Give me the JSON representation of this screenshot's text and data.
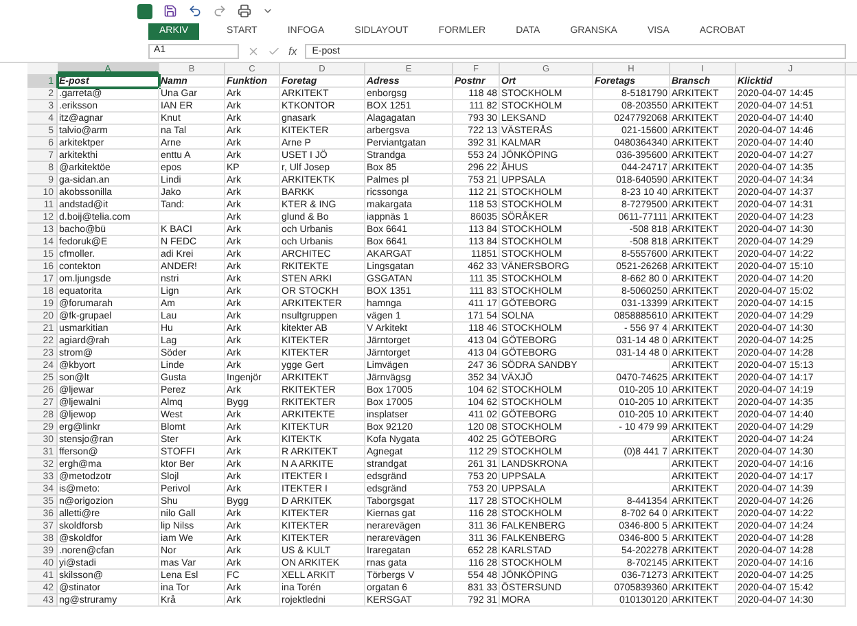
{
  "ribbon": {
    "tabs": [
      {
        "label": "ARKIV",
        "selected": true
      },
      {
        "label": "START",
        "selected": false
      },
      {
        "label": "INFOGA",
        "selected": false
      },
      {
        "label": "SIDLAYOUT",
        "selected": false
      },
      {
        "label": "FORMLER",
        "selected": false
      },
      {
        "label": "DATA",
        "selected": false
      },
      {
        "label": "GRANSKA",
        "selected": false
      },
      {
        "label": "VISA",
        "selected": false
      },
      {
        "label": "ACROBAT",
        "selected": false
      }
    ]
  },
  "formula_bar": {
    "name_box": "A1",
    "fx": "fx",
    "value": "E-post"
  },
  "columns": [
    {
      "letter": "A",
      "selected": true
    },
    {
      "letter": "B",
      "selected": false
    },
    {
      "letter": "C",
      "selected": false
    },
    {
      "letter": "D",
      "selected": false
    },
    {
      "letter": "E",
      "selected": false
    },
    {
      "letter": "F",
      "selected": false
    },
    {
      "letter": "G",
      "selected": false
    },
    {
      "letter": "H",
      "selected": false
    },
    {
      "letter": "I",
      "selected": false
    },
    {
      "letter": "J",
      "selected": false
    }
  ],
  "rows": [
    {
      "number": "1",
      "selected": true,
      "cells": [
        "E-post",
        "Namn",
        "Funktion",
        "Foretag",
        "Adress",
        "Postnr",
        "Ort",
        "Foretags",
        "Bransch",
        "Klicktid"
      ]
    },
    {
      "number": "2",
      "selected": false,
      "cells": [
        ".garreta@",
        "Una Gar",
        "Ark",
        "ARKITEKT",
        "enborgsg",
        "118 48",
        "STOCKHOLM",
        "8-5181790",
        "ARKITEKT",
        "2020-04-07 14:45"
      ]
    },
    {
      "number": "3",
      "selected": false,
      "cells": [
        ".eriksson",
        "IAN ER",
        "Ark",
        "KTKONTOR",
        "BOX 1251",
        "111 82",
        "STOCKHOLM",
        "08-203550",
        "ARKITEKT",
        "2020-04-07 14:51"
      ]
    },
    {
      "number": "4",
      "selected": false,
      "cells": [
        "itz@agnar",
        "Knut",
        "Ark",
        "gnasark",
        "Alagagatan",
        "793 30",
        "LEKSAND",
        "0247792068",
        "ARKITEKT",
        "2020-04-07 14:40"
      ]
    },
    {
      "number": "5",
      "selected": false,
      "cells": [
        "talvio@arm",
        "na Tal",
        "Ark",
        "KITEKTER",
        "arbergsva",
        "722 13",
        "VÄSTERÅS",
        "021-15600",
        "ARKITEKT",
        "2020-04-07 14:46"
      ]
    },
    {
      "number": "6",
      "selected": false,
      "cells": [
        "arkitektper",
        "Arne",
        "Ark",
        "Arne P",
        "Perviantgatan",
        "392 31",
        "KALMAR",
        "0480364340",
        "ARKITEKT",
        "2020-04-07 14:40"
      ]
    },
    {
      "number": "7",
      "selected": false,
      "cells": [
        "arkitekthi",
        "enttu A",
        "Ark",
        "USET I JÖ",
        "Strandga",
        "553 24",
        "JÖNKÖPING",
        "036-395600",
        "ARKITEKT",
        "2020-04-07 14:27"
      ]
    },
    {
      "number": "8",
      "selected": false,
      "cells": [
        "@arkitektöe",
        "epos",
        "KP",
        "r, Ulf Josep",
        "Box 85",
        "296 22",
        "ÅHUS",
        "044-24717",
        "ARKITEKT",
        "2020-04-07 14:35"
      ]
    },
    {
      "number": "9",
      "selected": false,
      "cells": [
        "ga-sidan.an",
        "Lindi",
        "Ark",
        "ARKITEKTK",
        "Palmes pl",
        "753 21",
        "UPPSALA",
        "018-640590",
        "ARKITEKT",
        "2020-04-07 14:34"
      ]
    },
    {
      "number": "10",
      "selected": false,
      "cells": [
        "akobssonilla",
        "Jako",
        "Ark",
        "BARKK",
        "ricssonga",
        "112 21",
        "STOCKHOLM",
        "8-23 10 40",
        "ARKITEKT",
        "2020-04-07 14:37"
      ]
    },
    {
      "number": "11",
      "selected": false,
      "cells": [
        "andstad@it",
        "Tand:",
        "Ark",
        "KTER & ING",
        "makargata",
        "118 53",
        "STOCKHOLM",
        "8-7279500",
        "ARKITEKT",
        "2020-04-07 14:31"
      ]
    },
    {
      "number": "12",
      "selected": false,
      "cells": [
        "d.boij@telia.com",
        null,
        "Ark",
        "glund & Bo",
        "iappnäs 1",
        "86035",
        "SÖRÅKER",
        "0611-77111",
        "ARKITEKT",
        "2020-04-07 14:23"
      ]
    },
    {
      "number": "13",
      "selected": false,
      "cells": [
        "bacho@bü",
        "K BACI",
        "Ark",
        "och Urbanis",
        "Box 6641",
        "113 84",
        "STOCKHOLM",
        "-508 818",
        "ARKITEKT",
        "2020-04-07 14:30"
      ]
    },
    {
      "number": "14",
      "selected": false,
      "cells": [
        "fedoruk@E",
        "N FEDC",
        "Ark",
        "och Urbanis",
        "Box 6641",
        "113 84",
        "STOCKHOLM",
        "-508 818",
        "ARKITEKT",
        "2020-04-07 14:29"
      ]
    },
    {
      "number": "15",
      "selected": false,
      "cells": [
        "cfmoller.",
        "adi Krei",
        "Ark",
        "ARCHITEC",
        "AKARGAT",
        "11851",
        "STOCKHOLM",
        "8-5557600",
        "ARKITEKT",
        "2020-04-07 14:22"
      ]
    },
    {
      "number": "16",
      "selected": false,
      "cells": [
        "contekton",
        "ANDER!",
        "Ark",
        "RKITEKTE",
        "Lingsgatan",
        "462 33",
        "VÄNERSBORG",
        "0521-26268",
        "ARKITEKT",
        "2020-04-07 15:10"
      ]
    },
    {
      "number": "17",
      "selected": false,
      "cells": [
        "om.ljungsde",
        "nstri",
        "Ark",
        "STEN ARKI",
        "GSGATAN",
        "111 35",
        "STOCKHOLM",
        "8-662 80 0",
        "ARKITEKT",
        "2020-04-07 14:20"
      ]
    },
    {
      "number": "18",
      "selected": false,
      "cells": [
        "equatorita",
        "Lign",
        "Ark",
        "OR STOCKH",
        "BOX 1351",
        "111 83",
        "STOCKHOLM",
        "8-5060250",
        "ARKITEKT",
        "2020-04-07 15:02"
      ]
    },
    {
      "number": "19",
      "selected": false,
      "cells": [
        "@forumarah",
        "Am",
        "Ark",
        "ARKITEKTER",
        "hamnga",
        "411 17",
        "GÖTEBORG",
        "031-13399",
        "ARKITEKT",
        "2020-04-07 14:15"
      ]
    },
    {
      "number": "20",
      "selected": false,
      "cells": [
        "@fk-grupael",
        "Lau",
        "Ark",
        "nsultgruppen",
        "vägen 1",
        "171 54",
        "SOLNA",
        "0858885610",
        "ARKITEKT",
        "2020-04-07 14:29"
      ]
    },
    {
      "number": "21",
      "selected": false,
      "cells": [
        "usmarkitian",
        "Hu",
        "Ark",
        "kitekter AB",
        "V Arkitekt",
        "118 46",
        "STOCKHOLM",
        "- 556 97 4",
        "ARKITEKT",
        "2020-04-07 14:30"
      ]
    },
    {
      "number": "22",
      "selected": false,
      "cells": [
        "agiard@rah",
        "Lag",
        "Ark",
        "KITEKTER",
        "Järntorget",
        "413 04",
        "GÖTEBORG",
        "031-14 48 0",
        "ARKITEKT",
        "2020-04-07 14:25"
      ]
    },
    {
      "number": "23",
      "selected": false,
      "cells": [
        "strom@",
        "Söder",
        "Ark",
        "KITEKTER",
        "Järntorget",
        "413 04",
        "GÖTEBORG",
        "031-14 48 0",
        "ARKITEKT",
        "2020-04-07 14:28"
      ]
    },
    {
      "number": "24",
      "selected": false,
      "cells": [
        "@kbyort",
        "Linde",
        "Ark",
        "ygge Gert",
        "Limvägen",
        "247 36",
        "SÖDRA SANDBY",
        null,
        "ARKITEKT",
        "2020-04-07 15:13"
      ]
    },
    {
      "number": "25",
      "selected": false,
      "cells": [
        "son@lt",
        "Gusta",
        "Ingenjör",
        "ARKITEKT",
        "Järnvägsg",
        "352 34",
        "VÄXJÖ",
        "0470-74625",
        "ARKITEKT",
        "2020-04-07 14:17"
      ]
    },
    {
      "number": "26",
      "selected": false,
      "cells": [
        "@ljewar",
        "Perez",
        "Ark",
        "RKITEKTER",
        "Box 17005",
        "104 62",
        "STOCKHOLM",
        "010-205 10",
        "ARKITEKT",
        "2020-04-07 14:19"
      ]
    },
    {
      "number": "27",
      "selected": false,
      "cells": [
        "@ljewalni",
        "Almq",
        "Bygg",
        "RKITEKTER",
        "Box 17005",
        "104 62",
        "STOCKHOLM",
        "010-205 10",
        "ARKITEKT",
        "2020-04-07 14:35"
      ]
    },
    {
      "number": "28",
      "selected": false,
      "cells": [
        "@ljewop",
        "West",
        "Ark",
        "ARKITEKTE",
        "insplatser",
        "411 02",
        "GÖTEBORG",
        "010-205 10",
        "ARKITEKT",
        "2020-04-07 14:40"
      ]
    },
    {
      "number": "29",
      "selected": false,
      "cells": [
        "erg@linkr",
        "Blomt",
        "Ark",
        "KITEKTUR",
        "Box 92120",
        "120 08",
        "STOCKHOLM",
        "- 10 479 99",
        "ARKITEKT",
        "2020-04-07 14:29"
      ]
    },
    {
      "number": "30",
      "selected": false,
      "cells": [
        "stensjo@ran",
        "Ster",
        "Ark",
        "KITEKTK",
        "Kofa Nygata",
        "402 25",
        "GÖTEBORG",
        null,
        "ARKITEKT",
        "2020-04-07 14:24"
      ]
    },
    {
      "number": "31",
      "selected": false,
      "cells": [
        "fferson@",
        "STOFFI",
        "Ark",
        "R ARKITEKT",
        "Agnegat",
        "112 29",
        "STOCKHOLM",
        "(0)8 441 7",
        "ARKITEKT",
        "2020-04-07 14:30"
      ]
    },
    {
      "number": "32",
      "selected": false,
      "cells": [
        "ergh@ma",
        "ktor Ber",
        "Ark",
        "N A ARKITE",
        "strandgat",
        "261 31",
        "LANDSKRONA",
        null,
        "ARKITEKT",
        "2020-04-07 14:16"
      ]
    },
    {
      "number": "33",
      "selected": false,
      "cells": [
        "@metodzotr",
        "Slojl",
        "Ark",
        "ITEKTER I",
        "edsgränd",
        "753 20",
        "UPPSALA",
        null,
        "ARKITEKT",
        "2020-04-07 14:17"
      ]
    },
    {
      "number": "34",
      "selected": false,
      "cells": [
        "is@meto:",
        "Perivol",
        "Ark",
        "ITEKTER I",
        "edsgränd",
        "753 20",
        "UPPSALA",
        null,
        "ARKITEKT",
        "2020-04-07 14:39"
      ]
    },
    {
      "number": "35",
      "selected": false,
      "cells": [
        "n@origozion",
        "Shu",
        "Bygg",
        "D ARKITEK",
        "Taborgsgat",
        "117 28",
        "STOCKHOLM",
        "8-441354",
        "ARKITEKT",
        "2020-04-07 14:26"
      ]
    },
    {
      "number": "36",
      "selected": false,
      "cells": [
        "alletti@re",
        "nilo Gall",
        "Ark",
        "KITEKTER",
        "Kiernas gat",
        "116 28",
        "STOCKHOLM",
        "8-702 64 0",
        "ARKITEKT",
        "2020-04-07 14:22"
      ]
    },
    {
      "number": "37",
      "selected": false,
      "cells": [
        "skoldforsb",
        "lip Nilss",
        "Ark",
        "KITEKTER",
        "nerarevägen",
        "311 36",
        "FALKENBERG",
        "0346-800 5",
        "ARKITEKT",
        "2020-04-07 14:24"
      ]
    },
    {
      "number": "38",
      "selected": false,
      "cells": [
        "@skoldfor",
        "iam We",
        "Ark",
        "KITEKTER",
        "nerarevägen",
        "311 36",
        "FALKENBERG",
        "0346-800 5",
        "ARKITEKT",
        "2020-04-07 14:28"
      ]
    },
    {
      "number": "39",
      "selected": false,
      "cells": [
        ".noren@cfan",
        "Nor",
        "Ark",
        "US & KULT",
        "Iraregatan",
        "652 28",
        "KARLSTAD",
        "54-202278",
        "ARKITEKT",
        "2020-04-07 14:28"
      ]
    },
    {
      "number": "40",
      "selected": false,
      "cells": [
        "yi@stadi",
        "mas Var",
        "Ark",
        "ON ARKITEK",
        "rnas gata",
        "116 28",
        "STOCKHOLM",
        "8-702145",
        "ARKITEKT",
        "2020-04-07 14:16"
      ]
    },
    {
      "number": "41",
      "selected": false,
      "cells": [
        "skilsson@",
        "Lena Esl",
        "FC",
        "XELL ARKIT",
        "Törbergs V",
        "554 48",
        "JÖNKÖPING",
        "036-71273",
        "ARKITEKT",
        "2020-04-07 14:25"
      ]
    },
    {
      "number": "42",
      "selected": false,
      "cells": [
        "@stinator",
        "ina Tor",
        "Ark",
        "ina Torén",
        "orgatan 6",
        "831 33",
        "ÖSTERSUND",
        "0705839360",
        "ARKITEKT",
        "2020-04-07 15:42"
      ]
    },
    {
      "number": "43",
      "selected": false,
      "cells": [
        "ng@struramy",
        "Krå",
        "Ark",
        "rojektledni",
        "KERSGAT",
        "792 31",
        "MORA",
        "010130120",
        "ARKITEKT",
        "2020-04-07 14:30"
      ]
    }
  ]
}
